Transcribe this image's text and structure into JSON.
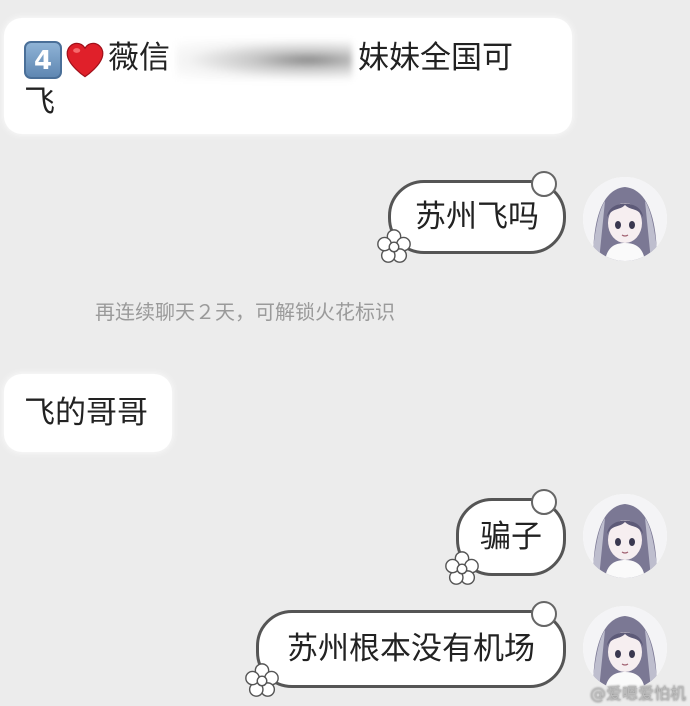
{
  "messages": [
    {
      "side": "left",
      "badge": "4",
      "text_before": "薇信",
      "text_after": "妹妹全国可",
      "text_line2": "飞"
    },
    {
      "side": "left",
      "text": "飞的哥哥"
    }
  ],
  "sent": [
    {
      "text": "苏州飞吗"
    },
    {
      "text": "骗子"
    },
    {
      "text": "苏州根本没有机场"
    }
  ],
  "system_notice": "再连续聊天２天，可解锁火花标识",
  "watermark": "@爱嗯爱怕机",
  "colors": {
    "background": "#ececec",
    "bubble": "#ffffff",
    "bubble_border": "#555555",
    "notice_text": "#9a9a9a",
    "heart": "#e0202a"
  },
  "icons": {
    "badge": "keycap-4-icon",
    "heart": "red-heart-icon",
    "avatar": "anime-girl-avatar-icon",
    "bubble_decoration": "flower-decoration-icon"
  }
}
